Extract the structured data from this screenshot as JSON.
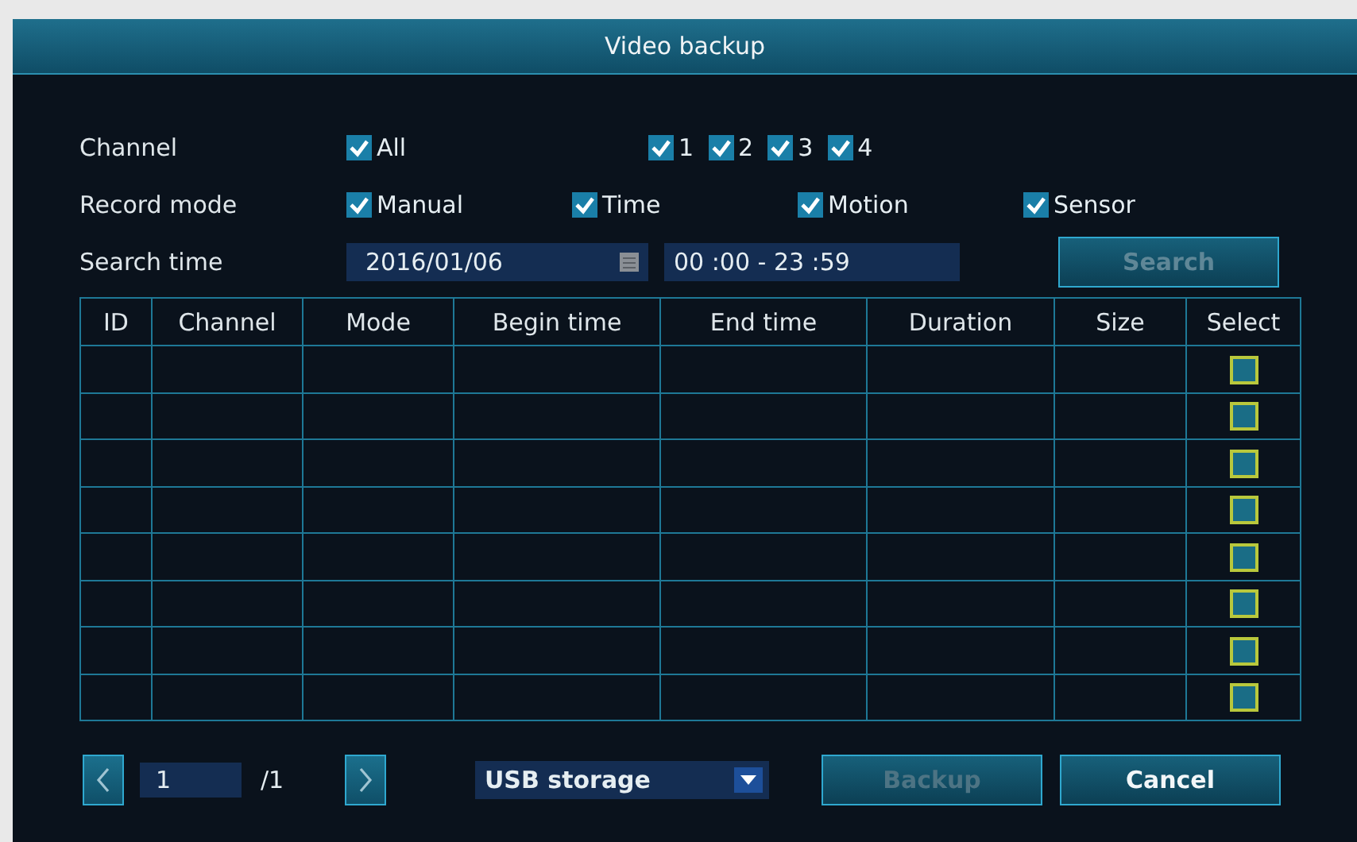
{
  "window": {
    "title": "Video backup"
  },
  "channel": {
    "label": "Channel",
    "options": [
      {
        "label": "All",
        "checked": true
      },
      {
        "label": "1",
        "checked": true
      },
      {
        "label": "2",
        "checked": true
      },
      {
        "label": "3",
        "checked": true
      },
      {
        "label": "4",
        "checked": true
      }
    ]
  },
  "record_mode": {
    "label": "Record mode",
    "options": [
      {
        "label": "Manual",
        "checked": true
      },
      {
        "label": "Time",
        "checked": true
      },
      {
        "label": "Motion",
        "checked": true
      },
      {
        "label": "Sensor",
        "checked": true
      }
    ]
  },
  "search_time": {
    "label": "Search time",
    "date": "2016/01/06",
    "time_range": "00 :00 - 23 :59"
  },
  "search_button": {
    "label": "Search",
    "disabled": true
  },
  "table": {
    "columns": [
      "ID",
      "Channel",
      "Mode",
      "Begin time",
      "End time",
      "Duration",
      "Size",
      "Select"
    ],
    "rows": [
      {
        "checked": false
      },
      {
        "checked": false
      },
      {
        "checked": false
      },
      {
        "checked": false
      },
      {
        "checked": false
      },
      {
        "checked": false
      },
      {
        "checked": false
      },
      {
        "checked": false
      }
    ]
  },
  "pagination": {
    "page": "1",
    "total": "/1"
  },
  "storage": {
    "value": "USB storage"
  },
  "buttons": [
    {
      "label": "Backup",
      "disabled": true
    },
    {
      "label": "Cancel",
      "disabled": false
    }
  ]
}
